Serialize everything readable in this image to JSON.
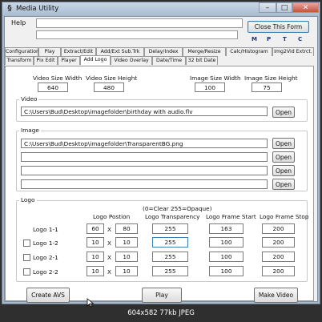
{
  "window": {
    "title": "Media Utility",
    "icon": "app-s-icon"
  },
  "title_controls": {
    "minimize": "–",
    "maximize": "□",
    "close": "✕"
  },
  "menu": {
    "help": "Help"
  },
  "top": {
    "close_label": "Close This Form",
    "mptc": [
      "M",
      "P",
      "T",
      "C"
    ]
  },
  "tabs_row1": [
    "Configuration",
    "Play",
    "Extract/Edit",
    "Add/Ext Sub.Trk",
    "Delay/Index",
    "Merge/Resize",
    "Calc/Histogram",
    "Img2Vid Extrct."
  ],
  "tabs_row2": [
    "Transform",
    "Pix Edit",
    "Player",
    "Add Logo",
    "Video Overlay",
    "Date/Time",
    "32 bit Date"
  ],
  "active_tab": "Add Logo",
  "sizes": {
    "video_width_label": "Video Size Width",
    "video_width": "640",
    "video_height_label": "Video Size Height",
    "video_height": "480",
    "image_width_label": "Image Size Width",
    "image_width": "100",
    "image_height_label": "Image Size Height",
    "image_height": "75"
  },
  "video_group": {
    "title": "Video",
    "path": "C:\\Users\\Bud\\Desktop\\imagefolder\\birthday with audio.flv",
    "open_label": "Open"
  },
  "image_group": {
    "title": "Image",
    "paths": [
      "C:\\Users\\Bud\\Desktop\\imagefolder\\TransparentBG.png",
      "",
      "",
      ""
    ],
    "open_label": "Open"
  },
  "logo_group": {
    "title": "Logo",
    "clear_note": "(0=Clear  255=Opaque)",
    "headers": {
      "position": "Logo Postion",
      "transparency": "Logo Transparency",
      "frame_start": "Logo Frame Start",
      "frame_stop": "Logo Frame Stop"
    },
    "x_sep": "X",
    "rows": [
      {
        "label": "Logo 1-1",
        "x": "60",
        "y": "80",
        "transparency": "255",
        "start": "163",
        "stop": "200",
        "checkbox": false
      },
      {
        "label": "Logo 1-2",
        "x": "10",
        "y": "10",
        "transparency": "255",
        "start": "100",
        "stop": "200",
        "checkbox": true
      },
      {
        "label": "Logo 2-1",
        "x": "10",
        "y": "10",
        "transparency": "255",
        "start": "100",
        "stop": "200",
        "checkbox": true
      },
      {
        "label": "Logo 2-2",
        "x": "10",
        "y": "10",
        "transparency": "255",
        "start": "100",
        "stop": "200",
        "checkbox": true
      }
    ]
  },
  "buttons": {
    "create_avs": "Create AVS",
    "play": "Play",
    "make_video": "Make Video"
  },
  "status_bar": "604x582  77kb  JPEG"
}
